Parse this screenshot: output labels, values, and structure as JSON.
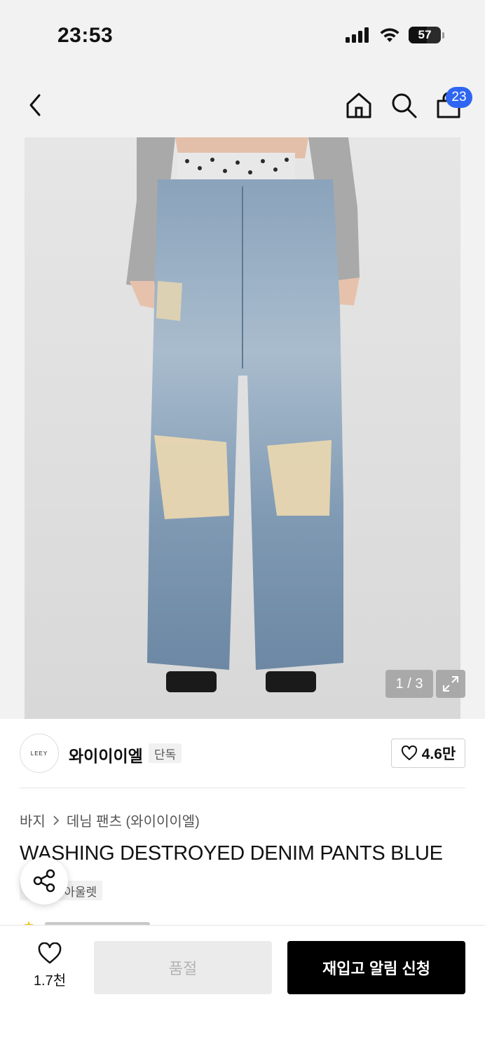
{
  "status": {
    "time": "23:53",
    "battery": "57",
    "battery_level": 0.57
  },
  "nav": {
    "cart_count": "23"
  },
  "gallery": {
    "page_indicator": "1 / 3"
  },
  "brand": {
    "logo_text": "LEEY",
    "name": "와이이이엘",
    "tag": "단독",
    "likes": "4.6만"
  },
  "breadcrumb": {
    "category": "바지",
    "subcategory": "데님 팬츠 (와이이이엘)"
  },
  "product": {
    "title": "WASHING DESTROYED DENIM PANTS BLUE",
    "tags": [
      "단독",
      "아울렛"
    ]
  },
  "bottom": {
    "wish_count": "1.7천",
    "soldout_label": "품절",
    "restock_label": "재입고 알림 신청"
  },
  "colors": {
    "badge": "#2f66f1",
    "primary_button": "#000000",
    "disabled_button": "#ebebeb",
    "rating_star": "#f0c419"
  },
  "icons": [
    "back-arrow-icon",
    "home-icon",
    "search-icon",
    "cart-icon",
    "expand-icon",
    "heart-icon",
    "share-icon",
    "star-icon"
  ]
}
